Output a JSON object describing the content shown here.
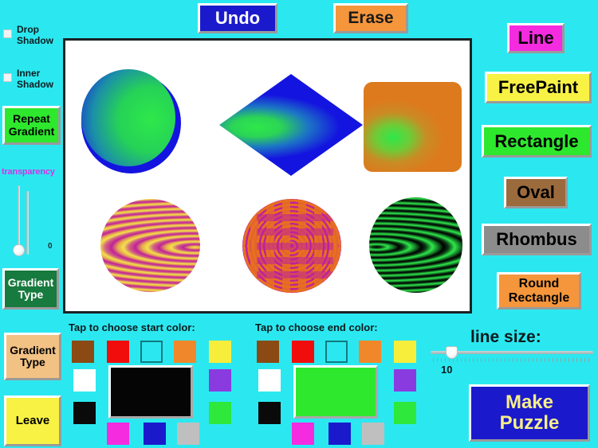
{
  "app": {
    "background_color": "#2BE8F0"
  },
  "toolbar": {
    "undo_label": "Undo",
    "undo_bg": "#1A1ACC",
    "undo_fg": "#FFFFFF",
    "erase_label": "Erase",
    "erase_bg": "#F5963C",
    "erase_fg": "#1A1A1A"
  },
  "options": {
    "checkboxes": [
      {
        "label": "Drop\nShadow",
        "checked": false
      },
      {
        "label": "Inner\nShadow",
        "checked": false
      }
    ],
    "repeat_gradient_label": "Repeat\nGradient",
    "repeat_gradient_bg": "#2EE82E",
    "transparency_label": "transparency",
    "transparency_value": "0",
    "transparency_label_color": "#D632E8",
    "gradient_type_green_label": "Gradient\nType",
    "gradient_type_green_bg": "#177A3E",
    "gradient_type_tan_label": "Gradient\nType",
    "gradient_type_tan_bg": "#F2C184",
    "leave_label": "Leave",
    "leave_bg": "#F7F244"
  },
  "shape_tools": [
    {
      "label": "Line",
      "bg": "#F52BE0",
      "fg": "#000000"
    },
    {
      "label": "FreePaint",
      "bg": "#F7F244",
      "fg": "#000000"
    },
    {
      "label": "Rectangle",
      "bg": "#2EE82E",
      "fg": "#000000"
    },
    {
      "label": "Oval",
      "bg": "#9B6B3D",
      "fg": "#000000"
    },
    {
      "label": "Rhombus",
      "bg": "#8C8C8C",
      "fg": "#000000"
    },
    {
      "label": "Round\nRectangle",
      "bg": "#F5963C",
      "fg": "#000000"
    }
  ],
  "canvas": {
    "background": "#FFFFFF",
    "border_color": "#1A2224",
    "shapes": [
      {
        "name": "oval-blue-green",
        "type": "oval",
        "start_color": "#1414E0",
        "end_color": "#22D84A"
      },
      {
        "name": "rhombus-blue-green",
        "type": "rhombus",
        "start_color": "#1414E0",
        "end_color": "#22D84A"
      },
      {
        "name": "round-rect-orange-green",
        "type": "round-rectangle",
        "start_color": "#DD7A1E",
        "end_color": "#22D84A"
      },
      {
        "name": "oval-yellow-magenta",
        "type": "oval",
        "start_color": "#F2E24A",
        "end_color": "#C0219B",
        "repeat": true
      },
      {
        "name": "oval-orange-magenta",
        "type": "oval",
        "start_color": "#E8701E",
        "end_color": "#C0219B",
        "repeat": true
      },
      {
        "name": "oval-green-black",
        "type": "oval",
        "start_color": "#22D84A",
        "end_color": "#000000",
        "repeat": true
      }
    ]
  },
  "start_palette": {
    "title": "Tap to choose start color:",
    "preview_color": "#050505",
    "swatches": [
      "#8B4A14",
      "#F20D0D",
      "transparent",
      "#F0882B",
      "#F7EE3C",
      "#FFFFFF",
      "#8A3BE0",
      "#0A0A0A",
      "#2EE83C",
      "#F52BE0",
      "#1A1ACC",
      "#BFBFBF"
    ]
  },
  "end_palette": {
    "title": "Tap to choose end color:",
    "preview_color": "#2EE82E",
    "swatches": [
      "#8B4A14",
      "#F20D0D",
      "transparent",
      "#F0882B",
      "#F7EE3C",
      "#FFFFFF",
      "#8A3BE0",
      "#0A0A0A",
      "#2EE83C",
      "#F52BE0",
      "#1A1ACC",
      "#BFBFBF"
    ]
  },
  "line_size": {
    "label": "line size:",
    "value": "10"
  },
  "make_puzzle": {
    "label": "Make\nPuzzle",
    "bg": "#1A1ACC",
    "fg": "#F7EE8A"
  }
}
